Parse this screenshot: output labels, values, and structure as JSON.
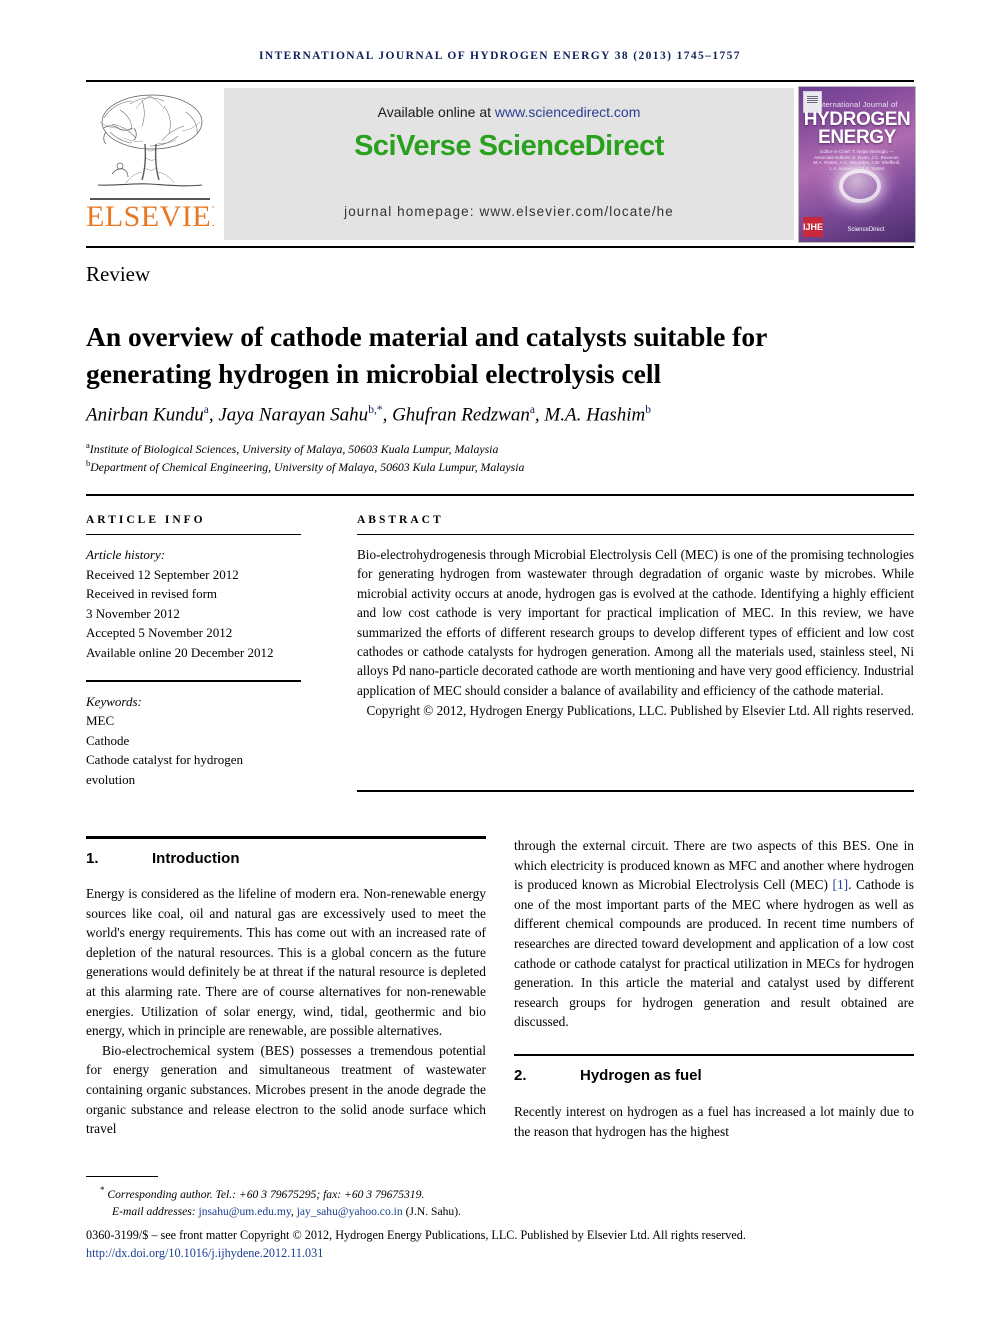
{
  "running_head": "INTERNATIONAL JOURNAL OF HYDROGEN ENERGY 38 (2013) 1745–1757",
  "masthead": {
    "elsevier_wordmark": "ELSEVIER",
    "available_prefix": "Available online at ",
    "available_url": "www.sciencedirect.com",
    "sciverse_first": "SciVerse ",
    "sciverse_second": "ScienceDirect",
    "journal_homepage": "journal homepage: www.elsevier.com/locate/he",
    "cover": {
      "line1": "International Journal of",
      "line2": "HYDROGEN",
      "line3": "ENERGY",
      "editors": "Editor-in-Chief: T. Nejat Veziroglu — Associate Editors: S. Dunn, J.C. Bowman, M.A. Rosen, A.C. Mourelos, J.W. Sheffield, L.A. Ismail and R.K. Yurteri",
      "badge": "IJHE",
      "sciencedirect": "ScienceDirect"
    }
  },
  "colors": {
    "elsevier_orange": "#e87722",
    "sciencedirect_green": "#2aa11e",
    "link_blue": "#1c3f94",
    "runhead_navy": "#11215c",
    "banner_grey": "#e3e3e3"
  },
  "article": {
    "doctype": "Review",
    "title": "An overview of cathode material and catalysts suitable for generating hydrogen in microbial electrolysis cell",
    "authors_html": "Anirban Kundu<sup>a</sup>, Jaya Narayan Sahu<sup>b,*</sup>, Ghufran Redzwan<sup>a</sup>, M.A. Hashim<sup>b</sup>",
    "affiliations": [
      {
        "mark": "a",
        "text": "Institute of Biological Sciences, University of Malaya, 50603 Kuala Lumpur, Malaysia"
      },
      {
        "mark": "b",
        "text": "Department of Chemical Engineering, University of Malaya, 50603 Kula Lumpur, Malaysia"
      }
    ]
  },
  "article_info": {
    "label": "ARTICLE INFO",
    "history_label": "Article history:",
    "history": [
      "Received 12 September 2012",
      "Received in revised form",
      "3 November 2012",
      "Accepted 5 November 2012",
      "Available online 20 December 2012"
    ],
    "keywords_label": "Keywords:",
    "keywords": [
      "MEC",
      "Cathode",
      "Cathode catalyst for hydrogen",
      "evolution"
    ]
  },
  "abstract": {
    "label": "ABSTRACT",
    "body": "Bio-electrohydrogenesis through Microbial Electrolysis Cell (MEC) is one of the promising technologies for generating hydrogen from wastewater through degradation of organic waste by microbes. While microbial activity occurs at anode, hydrogen gas is evolved at the cathode. Identifying a highly efficient and low cost cathode is very important for practical implication of MEC. In this review, we have summarized the efforts of different research groups to develop different types of efficient and low cost cathodes or cathode catalysts for hydrogen generation. Among all the materials used, stainless steel, Ni alloys Pd nano-particle decorated cathode are worth mentioning and have very good efficiency. Industrial application of MEC should consider a balance of availability and efficiency of the cathode material.",
    "copyright": "Copyright © 2012, Hydrogen Energy Publications, LLC. Published by Elsevier Ltd. All rights reserved."
  },
  "sections": {
    "intro": {
      "number": "1.",
      "title": "Introduction",
      "paragraphs": [
        "Energy is considered as the lifeline of modern era. Non-renewable energy sources like coal, oil and natural gas are excessively used to meet the world's energy requirements. This has come out with an increased rate of depletion of the natural resources. This is a global concern as the future generations would definitely be at threat if the natural resource is depleted at this alarming rate. There are of course alternatives for non-renewable energies. Utilization of solar energy, wind, tidal, geothermic and bio energy, which in principle are renewable, are possible alternatives.",
        "Bio-electrochemical system (BES) possesses a tremendous potential for energy generation and simultaneous treatment of wastewater containing organic substances. Microbes present in the anode degrade the organic substance and release electron to the solid anode surface which travel"
      ],
      "continuation_pre": "through the external circuit. There are two aspects of this BES. One in which electricity is produced known as MFC and another where hydrogen is produced known as Microbial Electrolysis Cell (MEC) ",
      "continuation_ref": "[1]",
      "continuation_post": ". Cathode is one of the most important parts of the MEC where hydrogen as well as different chemical compounds are produced. In recent time numbers of researches are directed toward development and application of a low cost cathode or cathode catalyst for practical utilization in MECs for hydrogen generation. In this article the material and catalyst used by different research groups for hydrogen generation and result obtained are discussed."
    },
    "hydrogen_fuel": {
      "number": "2.",
      "title": "Hydrogen as fuel",
      "paragraph": "Recently interest on hydrogen as a fuel has increased a lot mainly due to the reason that hydrogen has the highest"
    }
  },
  "footnotes": {
    "corresponding": "Corresponding author. Tel.: +60 3 79675295; fax: +60 3 79675319.",
    "email_label": "E-mail addresses:",
    "email_1": "jnsahu@um.edu.my",
    "email_sep": ", ",
    "email_2": "jay_sahu@yahoo.co.in",
    "email_suffix": " (J.N. Sahu).",
    "issn_line": "0360-3199/$ – see front matter Copyright © 2012, Hydrogen Energy Publications, LLC. Published by Elsevier Ltd. All rights reserved.",
    "doi": "http://dx.doi.org/10.1016/j.ijhydene.2012.11.031"
  }
}
